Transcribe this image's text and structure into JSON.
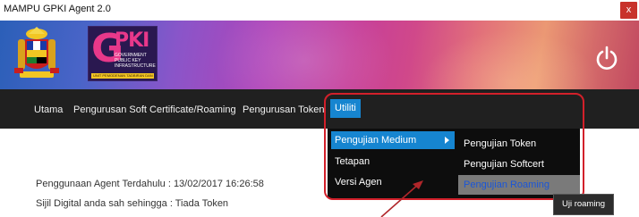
{
  "window": {
    "title": "MAMPU GPKI Agent 2.0",
    "close_label": "x"
  },
  "banner": {
    "crest_icon": "malaysia-coat-of-arms-icon",
    "logo_letters": "PKI",
    "logo_sub": "GOVERNMENT PUBLIC KEY INFRASTRUCTURE",
    "logo_foot": "UNIT PEMODENAN TADBIRAN DAN PERANCANGAN PENGURUSAN MALAYSIA",
    "power_icon": "power-icon"
  },
  "menubar": {
    "items": [
      {
        "label": "Utama"
      },
      {
        "label": "Pengurusan Soft Certificate/Roaming"
      },
      {
        "label": "Pengurusan Token"
      },
      {
        "label": "Utiliti"
      }
    ]
  },
  "dropdown": {
    "items": [
      {
        "label": "Pengujian Medium"
      },
      {
        "label": "Tetapan"
      },
      {
        "label": "Versi Agen"
      }
    ]
  },
  "submenu": {
    "items": [
      {
        "label": "Pengujian Token"
      },
      {
        "label": "Pengujian Softcert"
      },
      {
        "label": "Pengujian Roaming"
      }
    ]
  },
  "info": {
    "last_use_label": "Penggunaan Agent Terdahulu :",
    "last_use_value": "13/02/2017 16:26:58",
    "valid_label": "Sijil Digital anda sah sehingga :",
    "valid_value": "Tiada Token"
  },
  "uji_roaming_label": "Uji roaming",
  "colors": {
    "menubar_bg": "#202020",
    "accent_blue": "#1685d0",
    "annotation_red": "#d2202a",
    "close_red": "#c8322b"
  }
}
